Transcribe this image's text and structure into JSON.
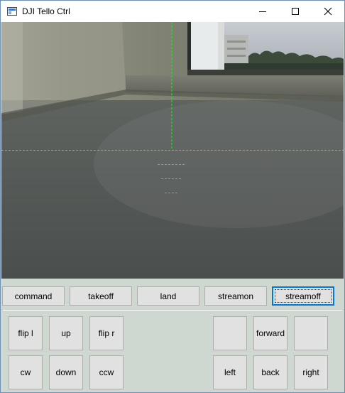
{
  "window": {
    "title": "DJI Tello Ctrl"
  },
  "video": {
    "hud_color": "#00ff00",
    "content": "live-camera-feed"
  },
  "stream_buttons": [
    {
      "label": "command"
    },
    {
      "label": "takeoff"
    },
    {
      "label": "land"
    },
    {
      "label": "streamon"
    },
    {
      "label": "streamoff"
    }
  ],
  "left_pad": {
    "row1": [
      {
        "label": "flip l"
      },
      {
        "label": "up"
      },
      {
        "label": "flip r"
      }
    ],
    "row2": [
      {
        "label": "cw"
      },
      {
        "label": "down"
      },
      {
        "label": "ccw"
      }
    ]
  },
  "right_pad": {
    "row1": [
      {
        "label": ""
      },
      {
        "label": "forward"
      },
      {
        "label": ""
      }
    ],
    "row2": [
      {
        "label": "left"
      },
      {
        "label": "back"
      },
      {
        "label": "right"
      }
    ]
  },
  "colors": {
    "focus": "#0078d7",
    "panel": "#cfd8d0",
    "button": "#e1e1e1"
  }
}
